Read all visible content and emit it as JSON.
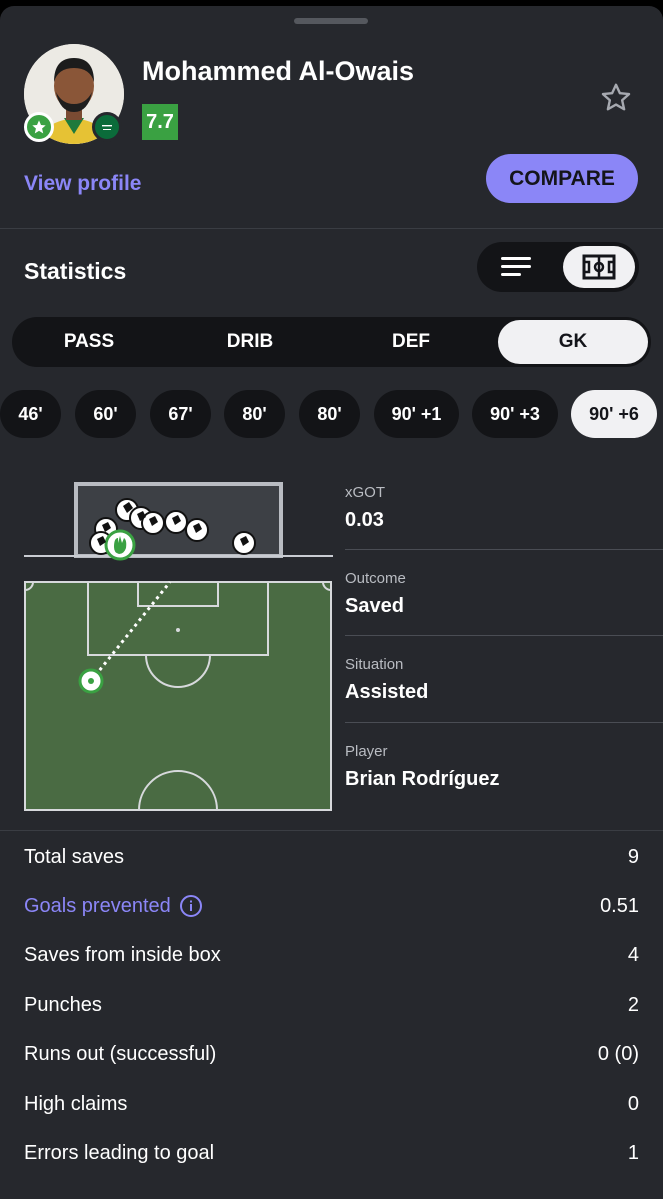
{
  "player": {
    "name": "Mohammed Al-Owais",
    "rating": "7.7",
    "view_profile_label": "View profile",
    "compare_label": "COMPARE",
    "colors": {
      "rating_bg": "#3aa142",
      "accent": "#8b86f7"
    }
  },
  "statistics": {
    "title": "Statistics",
    "view_modes": [
      "list-icon",
      "pitch-icon"
    ],
    "active_view": "pitch-icon"
  },
  "tabs": [
    {
      "label": "PASS",
      "active": false
    },
    {
      "label": "DRIB",
      "active": false
    },
    {
      "label": "DEF",
      "active": false
    },
    {
      "label": "GK",
      "active": true
    }
  ],
  "minutes": [
    {
      "label": "46'",
      "active": false
    },
    {
      "label": "60'",
      "active": false
    },
    {
      "label": "67'",
      "active": false
    },
    {
      "label": "80'",
      "active": false
    },
    {
      "label": "80'",
      "active": false
    },
    {
      "label": "90' +1",
      "active": false
    },
    {
      "label": "90' +3",
      "active": false
    },
    {
      "label": "90' +6",
      "active": true
    }
  ],
  "shot_info": [
    {
      "label": "xGOT",
      "value": "0.03"
    },
    {
      "label": "Outcome",
      "value": "Saved"
    },
    {
      "label": "Situation",
      "value": "Assisted"
    },
    {
      "label": "Player",
      "value": "Brian Rodríguez"
    }
  ],
  "gk_stats": [
    {
      "label": "Total saves",
      "value": "9",
      "link": false
    },
    {
      "label": "Goals prevented",
      "value": "0.51",
      "link": true,
      "icon": "info-icon"
    },
    {
      "label": "Saves from inside box",
      "value": "4",
      "link": false
    },
    {
      "label": "Punches",
      "value": "2",
      "link": false
    },
    {
      "label": "Runs out (successful)",
      "value": "0 (0)",
      "link": false
    },
    {
      "label": "High claims",
      "value": "0",
      "link": false
    },
    {
      "label": "Errors leading to goal",
      "value": "1",
      "link": false
    }
  ]
}
